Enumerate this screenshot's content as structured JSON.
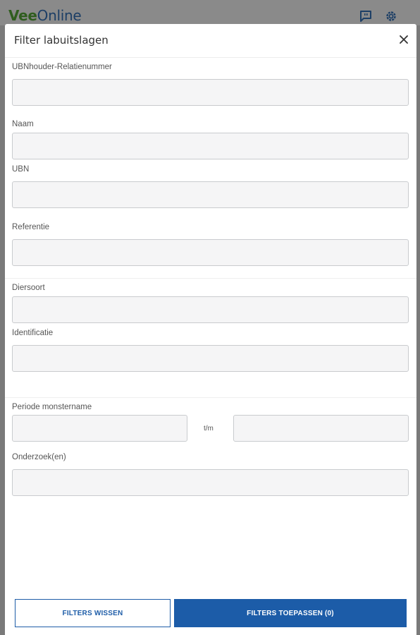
{
  "app": {
    "brand_part1": "Vee",
    "brand_part2": "Online",
    "icons": [
      "feedback-icon",
      "settings-gear-icon"
    ]
  },
  "modal": {
    "title": "Filter labuitslagen",
    "close_icon": "close-icon"
  },
  "fields": {
    "ubnhouder_label": "UBNhouder-Relatienummer",
    "naam_label": "Naam",
    "ubn_label": "UBN",
    "referentie_label": "Referentie",
    "diersoort_label": "Diersoort",
    "identificatie_label": "Identificatie",
    "periode_label": "Periode monstername",
    "periode_separator": "t/m",
    "onderzoeken_label": "Onderzoek(en)"
  },
  "buttons": {
    "clear_label": "FILTERS WISSEN",
    "apply_label": "FILTERS TOEPASSEN (0)"
  },
  "colors": {
    "brand_green": "#2f5d1e",
    "brand_blue": "#1d3f66",
    "primary": "#1c5ca8",
    "field_bg": "#f5f5f6",
    "field_border": "#c9cbce"
  }
}
